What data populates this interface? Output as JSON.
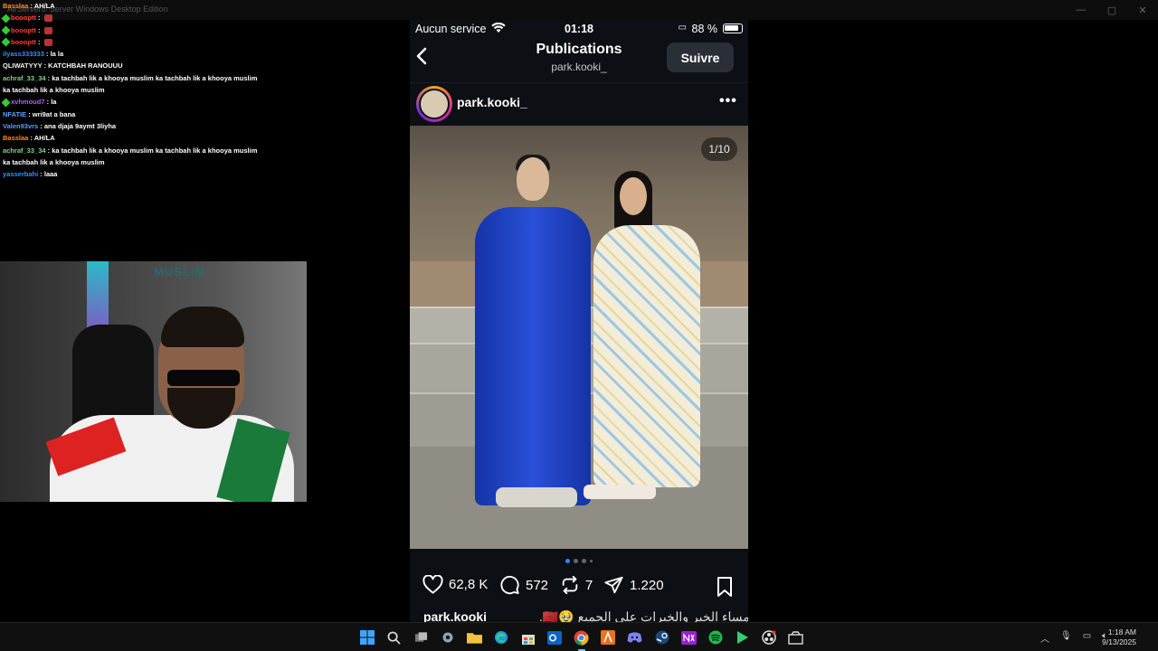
{
  "window": {
    "title": "AirServer® Server Windows Desktop Edition",
    "controls": [
      "—",
      "▢",
      "✕"
    ]
  },
  "chat": [
    {
      "user": "Basslaa",
      "color": "#ff8c1a",
      "text": "AH/LA",
      "badge": false,
      "emote": false
    },
    {
      "user": "boooptt",
      "color": "#ff3b3b",
      "text": "",
      "badge": true,
      "emote": true
    },
    {
      "user": "boooptt",
      "color": "#ff3b3b",
      "text": "",
      "badge": true,
      "emote": true
    },
    {
      "user": "boooptt",
      "color": "#ff3b3b",
      "text": "",
      "badge": true,
      "emote": true
    },
    {
      "user": "ilyass333333",
      "color": "#3c8cff",
      "text": "la la",
      "badge": false,
      "emote": false
    },
    {
      "user": "QLIWATYYY",
      "color": "#f4f4f4",
      "text": "KATCHBAH RANOUUU",
      "badge": false,
      "emote": false
    },
    {
      "user": "achraf_33_34",
      "color": "#7fd48a",
      "text": "ka tachbah lik a khooya muslim ka tachbah lik a khooya muslim ka tachbah lik a khooya muslim",
      "badge": false,
      "emote": false
    },
    {
      "user": "xvhmoud7",
      "color": "#b45cff",
      "text": "la",
      "badge": true,
      "emote": false
    },
    {
      "user": "NFATIE",
      "color": "#5aa0ff",
      "text": "wri9at a bana",
      "badge": false,
      "emote": false
    },
    {
      "user": "Valen93vrs",
      "color": "#5aa0ff",
      "text": "ana djaja 9aymt 3liyha",
      "badge": false,
      "emote": false
    },
    {
      "user": "Basslaa",
      "color": "#ff8c1a",
      "text": "AH/LA",
      "badge": false,
      "emote": false
    },
    {
      "user": "achraf_33_34",
      "color": "#7fd48a",
      "text": "ka tachbah lik a khooya muslim ka tachbah lik a khooya muslim ka tachbah lik a khooya muslim",
      "badge": false,
      "emote": false
    },
    {
      "user": "yasserbahi",
      "color": "#3c8cff",
      "text": "laaa",
      "badge": false,
      "emote": false
    }
  ],
  "webcam": {
    "sign_text": "MUSLIM"
  },
  "phone": {
    "status": {
      "carrier": "Aucun service",
      "time": "01:18",
      "battery": "88 %"
    },
    "nav": {
      "title": "Publications",
      "subtitle": "park.kooki_",
      "follow_label": "Suivre"
    },
    "post": {
      "username": "park.kooki_",
      "counter": "1/10",
      "likes": "62,8 K",
      "comments": "572",
      "reposts": "7",
      "shares": "1.220",
      "caption_user": "park.kooki",
      "caption_text": "مساء الخير والخيرات على الجميع 🥹🇲🇦."
    }
  },
  "taskbar": {
    "apps": [
      "windows",
      "search",
      "task-view",
      "settings",
      "file-explorer",
      "edge",
      "store",
      "outlook",
      "chrome",
      "adobe",
      "discord",
      "steam",
      "next",
      "spotify",
      "game",
      "obs",
      "capture"
    ],
    "clock_time": "1:18 AM",
    "clock_date": "9/13/2025"
  }
}
